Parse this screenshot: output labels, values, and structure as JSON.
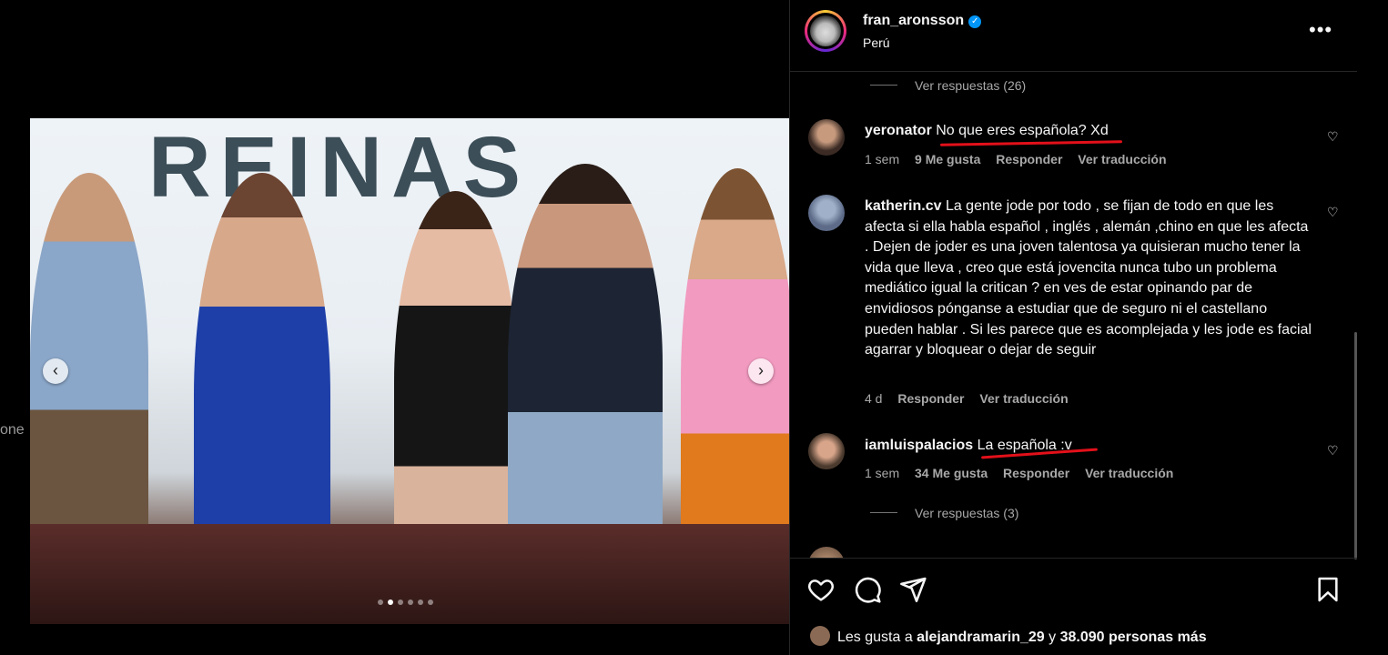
{
  "backdrop": {
    "edge_text": "one"
  },
  "photo": {
    "banner_text": "REINAS",
    "carousel": {
      "total": 6,
      "active_index": 1
    }
  },
  "post_header": {
    "username": "fran_aronsson",
    "location": "Perú",
    "verified_icon": "verified-badge-icon",
    "more_label": "•••"
  },
  "comments": {
    "top_replies_label": "Ver respuestas (26)",
    "items": [
      {
        "user": "yeronator",
        "text": "No que eres española? Xd",
        "time": "1 sem",
        "likes": "9 Me gusta",
        "reply_label": "Responder",
        "translate_label": "Ver traducción"
      },
      {
        "user": "katherin.cv",
        "text": "La gente jode por todo , se fijan de todo en que les afecta si ella habla español , inglés , alemán ,chino en que les afecta . Dejen de joder es una joven talentosa ya quisieran mucho tener la vida que lleva , creo que está jovencita nunca tubo un problema mediático igual la critican ? en ves de estar opinando par de envidiosos pónganse a estudiar que de seguro ni el castellano pueden hablar . Si les parece que es acomplejada y les jode es facial agarrar y bloquear o dejar de seguir",
        "time": "4 d",
        "reply_label": "Responder",
        "translate_label": "Ver traducción"
      },
      {
        "user": "iamluispalacios",
        "text": "La española :v",
        "time": "1 sem",
        "likes": "34 Me gusta",
        "reply_label": "Responder",
        "translate_label": "Ver traducción",
        "replies_label": "Ver respuestas (3)"
      }
    ]
  },
  "actions": {
    "like_icon": "heart-icon",
    "comment_icon": "comment-icon",
    "share_icon": "send-icon",
    "save_icon": "bookmark-icon"
  },
  "likes_summary": {
    "prefix": "Les gusta a ",
    "user": "alejandramarin_29",
    "middle": " y ",
    "count": "38.090 personas más"
  },
  "colors": {
    "accent": "#0095f6",
    "annotation_red": "#e3101a",
    "background": "#000000"
  }
}
